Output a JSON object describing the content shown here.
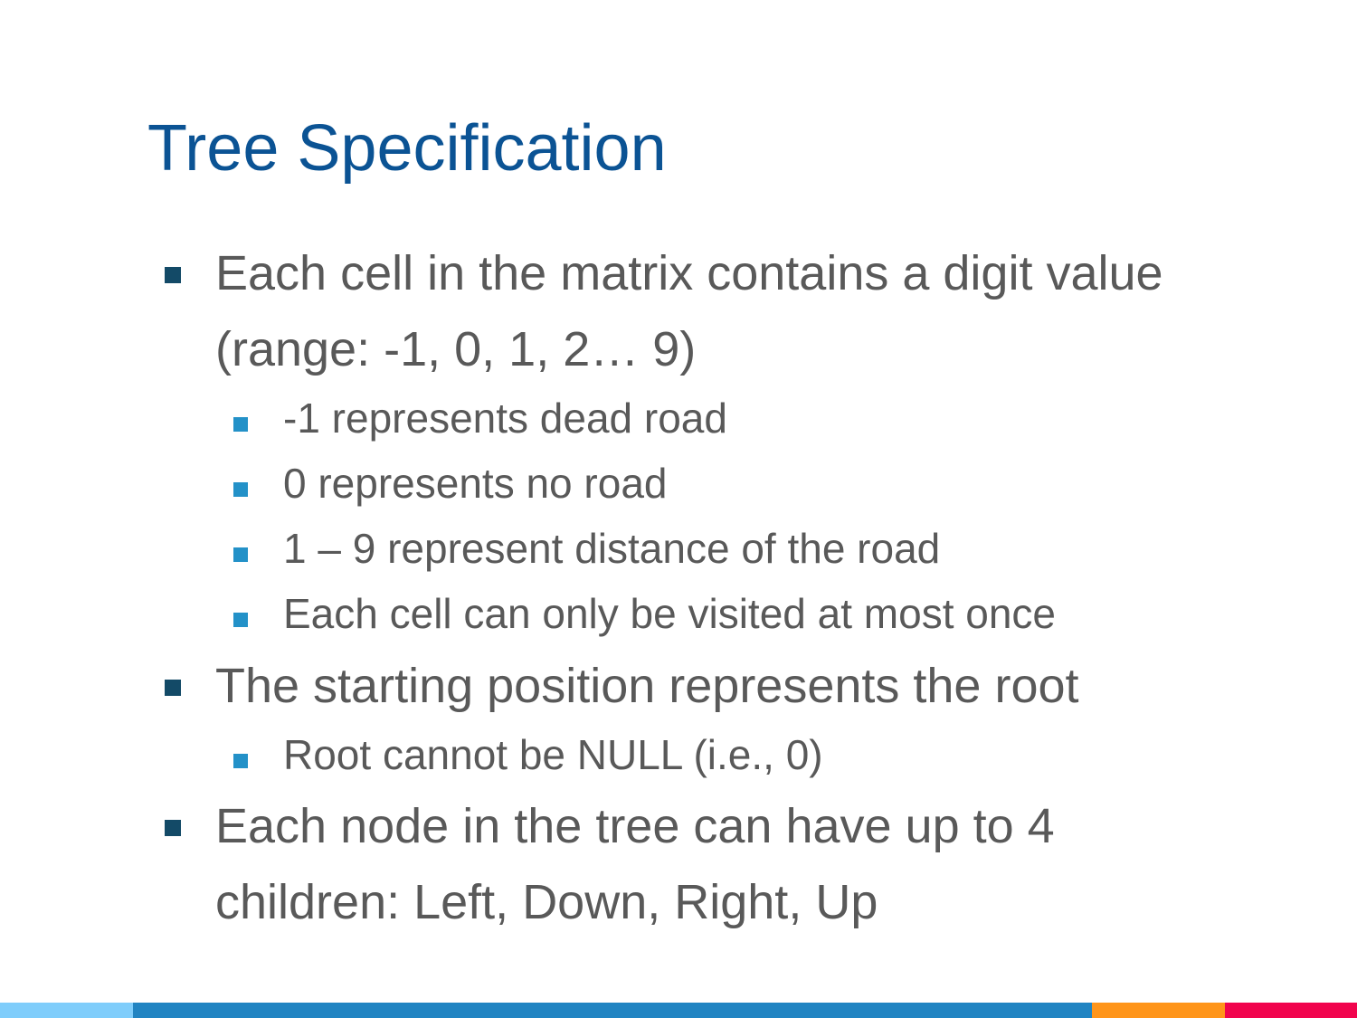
{
  "title": "Tree Specification",
  "bullets": [
    {
      "level": 1,
      "text": "Each cell in the matrix contains a digit value (range: -1, 0, 1, 2… 9)"
    },
    {
      "level": 2,
      "text": "-1 represents dead road"
    },
    {
      "level": 2,
      "text": "0 represents no road"
    },
    {
      "level": 2,
      "text": "1 – 9 represent distance of the road"
    },
    {
      "level": 2,
      "text": "Each cell can only be visited at most once"
    },
    {
      "level": 1,
      "text": "The starting position represents the root"
    },
    {
      "level": 2,
      "text": "Root cannot be NULL (i.e., 0)"
    },
    {
      "level": 1,
      "text": "Each node in the tree can have up to 4 children: Left, Down, Right, Up"
    }
  ],
  "colors": {
    "title": "#0b5394",
    "text": "#595959",
    "bullet_level1": "#134a67",
    "bullet_level2": "#2391c8",
    "footer_bar": [
      "#7fcdfb",
      "#2184c2",
      "#ff951a",
      "#f1044d"
    ]
  }
}
